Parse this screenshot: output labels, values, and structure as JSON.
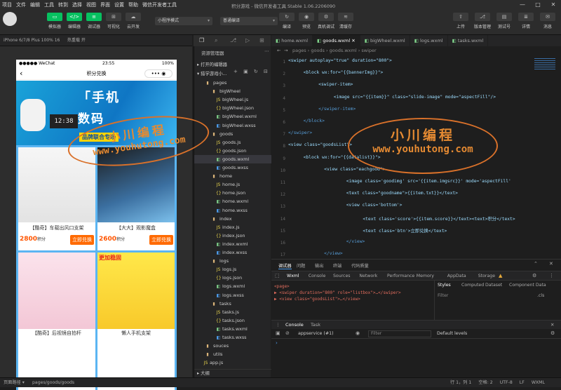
{
  "window": {
    "title": "积分游戏 - 微信开发者工具 Stable 1.06.2206090",
    "controls": [
      "—",
      "□",
      "✕"
    ]
  },
  "menu": [
    "项目",
    "文件",
    "编辑",
    "工具",
    "转到",
    "选择",
    "视图",
    "界面",
    "设置",
    "帮助",
    "微信开发者工具"
  ],
  "toolbar": {
    "left": [
      {
        "icon": "▭",
        "label": "模拟器"
      },
      {
        "icon": "</>",
        "label": "编辑器"
      },
      {
        "icon": "≡",
        "label": "调试器"
      },
      {
        "icon": "⊞",
        "label": "可视化"
      },
      {
        "icon": "☁",
        "label": "云开发"
      }
    ],
    "mode_select": "小程序模式",
    "compile_select": "普通编译",
    "actions": [
      {
        "icon": "↻",
        "label": "编译"
      },
      {
        "icon": "◉",
        "label": "预览"
      },
      {
        "icon": "⚙",
        "label": "真机调试"
      },
      {
        "icon": "≋",
        "label": "清缓存"
      }
    ],
    "right": [
      {
        "icon": "⇧",
        "label": "上传"
      },
      {
        "icon": "⎇",
        "label": "版本管理"
      },
      {
        "icon": "▤",
        "label": "测试号"
      },
      {
        "icon": "≣",
        "label": "详情"
      },
      {
        "icon": "✉",
        "label": "消息"
      }
    ]
  },
  "device": {
    "model": "iPhone 6/7/8 Plus 100% 16",
    "hotreload": "热重载 开"
  },
  "phone": {
    "status": {
      "carrier": "●●●●● WeChat",
      "time": "23:55",
      "battery": "100%"
    },
    "nav_title": "积分兑换",
    "nav_back": "‹",
    "nav_capsule": "•••  ◉",
    "banner": {
      "line1": "「手机",
      "line2": "数码",
      "tag": "品牌联合专场"
    },
    "products": [
      {
        "name": "【酷奇】车载出风口支架",
        "score": "2800",
        "unit": "积分",
        "btn": "立即兑换"
      },
      {
        "name": "【大大】观影魔盒",
        "score": "2600",
        "unit": "积分",
        "btn": "立即兑换"
      },
      {
        "name": "【酷奇】后视镜自拍杆",
        "score": "",
        "unit": "",
        "btn": ""
      },
      {
        "name": "懒人手机支架",
        "score": "",
        "unit": "",
        "btn": "",
        "label": "更加稳固"
      }
    ]
  },
  "explorer": {
    "header": "资源管理器",
    "section1": "打开的编辑器",
    "section2": "猎学游戏小...",
    "tree": [
      {
        "name": "pages",
        "type": "folder",
        "depth": 1
      },
      {
        "name": "bigWheel",
        "type": "folder",
        "depth": 2
      },
      {
        "name": "bigWheel.js",
        "type": "js",
        "depth": 3
      },
      {
        "name": "bigWheel.json",
        "type": "json",
        "depth": 3
      },
      {
        "name": "bigWheel.wxml",
        "type": "wxml",
        "depth": 3
      },
      {
        "name": "bigWheel.wxss",
        "type": "wxss",
        "depth": 3
      },
      {
        "name": "goods",
        "type": "folder",
        "depth": 2
      },
      {
        "name": "goods.js",
        "type": "js",
        "depth": 3
      },
      {
        "name": "goods.json",
        "type": "json",
        "depth": 3
      },
      {
        "name": "goods.wxml",
        "type": "wxml",
        "depth": 3,
        "selected": true
      },
      {
        "name": "goods.wxss",
        "type": "wxss",
        "depth": 3
      },
      {
        "name": "home",
        "type": "folder",
        "depth": 2
      },
      {
        "name": "home.js",
        "type": "js",
        "depth": 3
      },
      {
        "name": "home.json",
        "type": "json",
        "depth": 3
      },
      {
        "name": "home.wxml",
        "type": "wxml",
        "depth": 3
      },
      {
        "name": "home.wxss",
        "type": "wxss",
        "depth": 3
      },
      {
        "name": "index",
        "type": "folder",
        "depth": 2
      },
      {
        "name": "index.js",
        "type": "js",
        "depth": 3
      },
      {
        "name": "index.json",
        "type": "json",
        "depth": 3
      },
      {
        "name": "index.wxml",
        "type": "wxml",
        "depth": 3
      },
      {
        "name": "index.wxss",
        "type": "wxss",
        "depth": 3
      },
      {
        "name": "logs",
        "type": "folder",
        "depth": 2
      },
      {
        "name": "logs.js",
        "type": "js",
        "depth": 3
      },
      {
        "name": "logs.json",
        "type": "json",
        "depth": 3
      },
      {
        "name": "logs.wxml",
        "type": "wxml",
        "depth": 3
      },
      {
        "name": "logs.wxss",
        "type": "wxss",
        "depth": 3
      },
      {
        "name": "tasks",
        "type": "folder",
        "depth": 2
      },
      {
        "name": "tasks.js",
        "type": "js",
        "depth": 3
      },
      {
        "name": "tasks.json",
        "type": "json",
        "depth": 3
      },
      {
        "name": "tasks.wxml",
        "type": "wxml",
        "depth": 3
      },
      {
        "name": "tasks.wxss",
        "type": "wxss",
        "depth": 3
      },
      {
        "name": "souces",
        "type": "folder",
        "depth": 1
      },
      {
        "name": "utils",
        "type": "folder",
        "depth": 1
      },
      {
        "name": "app.js",
        "type": "js",
        "depth": 1
      }
    ],
    "outline": "大纲"
  },
  "tabs": [
    "home.wxml",
    "goods.wxml",
    "bigWheel.wxml",
    "logs.wxml",
    "tasks.wxml"
  ],
  "breadcrumb": "pages › goods › goods.wxml › swiper",
  "code": [
    "<swiper autoplay=\"true\" duration=\"800\">",
    "  <block wx:for=\"{{bannerImg}}\">",
    "    <swiper-item>",
    "      <image src=\"{{item}}\" class=\"slide-image\" mode=\"aspectFill\"/>",
    "    </swiper-item>",
    "  </block>",
    "</swiper>",
    "<view class=\"goodsList\">",
    "  <block wx:for=\"{{datalist}}\">",
    "    <view class=\"eachgood\">",
    "      <image class='goodimg' src='{{item.imgsrc}}' mode='aspectFill'",
    "      <text class=\"goodname\">{{item.txt}}</text>",
    "      <view class='bottom'>",
    "        <text class='score'>{{item.score}}</text><text>积分</text>",
    "        <text class='btn'>立即兑换</text>",
    "      </view>",
    "    </view>"
  ],
  "watermark": {
    "cn": "小川编程",
    "url": "www.youhutong.com"
  },
  "devtools": {
    "top_tabs": [
      "调试器",
      "问题",
      "输出",
      "终端",
      "代码质量"
    ],
    "panel_tabs": [
      "Wxml",
      "Console",
      "Sources",
      "Network",
      "Performance",
      "Memory",
      "AppData",
      "Storage"
    ],
    "wxml_lines": [
      "<page>",
      "  ▶ <swiper duration=\"800\" role=\"listbox\">…</swiper>",
      "  ▶ <view class=\"goodsList\">…</view>"
    ],
    "style_tabs": [
      "Styles",
      "Computed",
      "Dataset",
      "Component Data"
    ],
    "filter_placeholder": "Filter",
    "cls": ".cls",
    "console_tabs": [
      "Console",
      "Task"
    ],
    "context": "appservice (#1)",
    "console_filter": "Filter",
    "levels": "Default levels"
  },
  "statusbar": {
    "left": "页面路径 ▾",
    "path": "pages/goods/goods",
    "right": [
      "行 1，列 1",
      "空格: 2",
      "UTF-8",
      "LF",
      "WXML"
    ]
  }
}
